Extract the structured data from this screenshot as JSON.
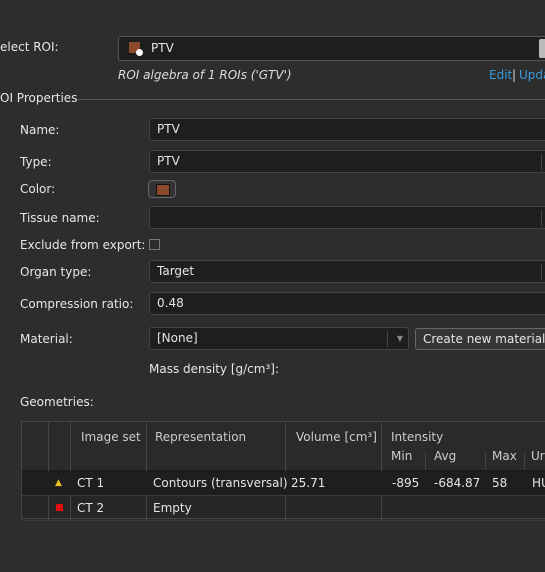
{
  "select_roi": {
    "label": "elect ROI:",
    "value": "PTV",
    "color": "#8b4a2b",
    "subtitle": "ROI algebra of 1 ROIs ('GTV')",
    "edit": "Edit",
    "separator": "|",
    "update": "Upda"
  },
  "section": {
    "title": "OI Properties"
  },
  "props": {
    "name_label": "Name:",
    "name_value": "PTV",
    "type_label": "Type:",
    "type_value": "PTV",
    "color_label": "Color:",
    "color_value": "#8b4a2b",
    "tissue_label": "Tissue name:",
    "tissue_value": "",
    "exclude_label": "Exclude from export:",
    "exclude_checked": false,
    "organ_label": "Organ type:",
    "organ_value": "Target",
    "compression_label": "Compression ratio:",
    "compression_value": "0.48",
    "material_label": "Material:",
    "material_value": "[None]",
    "create_material": "Create new material...",
    "mass_density_label": "Mass density [g/cm³]:"
  },
  "geometries": {
    "label": "Geometries:",
    "headers": {
      "image_set": "Image set",
      "representation": "Representation",
      "volume": "Volume [cm³]",
      "intensity": "Intensity",
      "min": "Min",
      "avg": "Avg",
      "max": "Max",
      "unit": "Ur"
    },
    "rows": [
      {
        "status_icon": "warning-triangle",
        "status_color": "#e8c020",
        "image_set": "CT 1",
        "representation": "Contours (transversal)",
        "volume": "25.71",
        "min": "-895",
        "avg": "-684.87",
        "max": "58",
        "unit": "HU"
      },
      {
        "status_icon": "error-square",
        "status_color": "#e01010",
        "image_set": "CT 2",
        "representation": "Empty",
        "volume": "",
        "min": "",
        "avg": "",
        "max": "",
        "unit": ""
      }
    ]
  }
}
